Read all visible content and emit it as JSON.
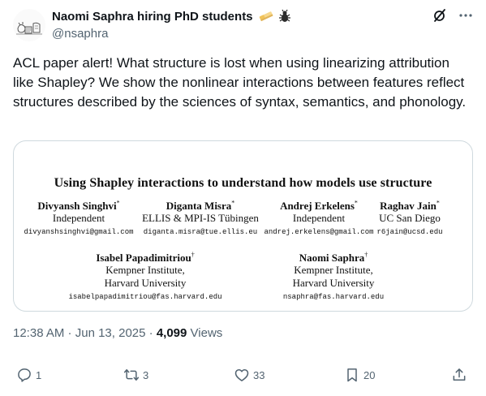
{
  "author": {
    "display_name": "Naomi Saphra hiring PhD students",
    "emoji": [
      "eraser-emoji",
      "bug-emoji"
    ],
    "handle": "@nsaphra"
  },
  "tweet": {
    "text": "ACL paper alert! What structure is lost when using linearizing attribution like Shapley? We show the nonlinear interactions between features reflect structures described by the sciences of syntax, semantics, and phonology."
  },
  "paper": {
    "title": "Using Shapley interactions to understand how models use structure",
    "authors": [
      {
        "name": "Divyansh Singhvi",
        "mark": "*",
        "affiliation": [
          "Independent"
        ],
        "email": "divyanshsinghvi@gmail.com"
      },
      {
        "name": "Diganta Misra",
        "mark": "*",
        "affiliation": [
          "ELLIS & MPI-IS Tübingen"
        ],
        "email": "diganta.misra@tue.ellis.eu"
      },
      {
        "name": "Andrej Erkelens",
        "mark": "*",
        "affiliation": [
          "Independent"
        ],
        "email": "andrej.erkelens@gmail.com"
      },
      {
        "name": "Raghav Jain",
        "mark": "*",
        "affiliation": [
          "UC San Diego"
        ],
        "email": "r6jain@ucsd.edu"
      },
      {
        "name": "Isabel Papadimitriou",
        "mark": "†",
        "affiliation": [
          "Kempner Institute,",
          "Harvard University"
        ],
        "email": "isabelpapadimitriou@fas.harvard.edu"
      },
      {
        "name": "Naomi Saphra",
        "mark": "†",
        "affiliation": [
          "Kempner Institute,",
          "Harvard University"
        ],
        "email": "nsaphra@fas.harvard.edu"
      }
    ]
  },
  "meta": {
    "time": "12:38 AM",
    "sep1": " · ",
    "date": "Jun 13, 2025",
    "sep2": " · ",
    "views_count": "4,099",
    "views_label": " Views"
  },
  "actions": {
    "reply_count": "1",
    "repost_count": "3",
    "like_count": "33",
    "bookmark_count": "20"
  },
  "colors": {
    "text": "#0f1419",
    "secondary": "#536471",
    "border": "#cfd9de"
  }
}
